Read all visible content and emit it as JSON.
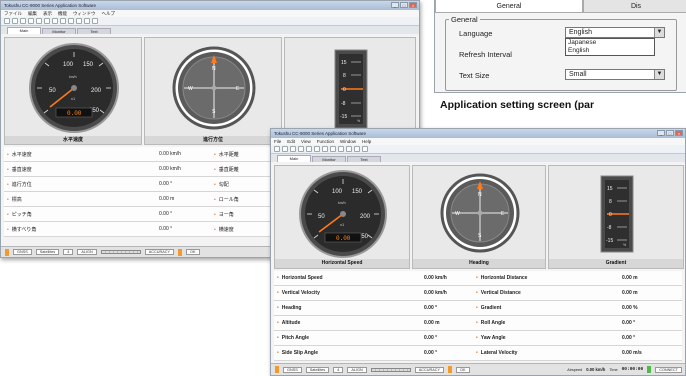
{
  "small_window": {
    "title": "Tokushu CC-9000 Series Application Software",
    "menu": [
      "ファイル",
      "編集",
      "表示",
      "機能",
      "ウィンドウ",
      "ヘルプ"
    ],
    "tabs": [
      "Main",
      "Monitor",
      "Text"
    ],
    "speed_panel": {
      "caption": "水平速度",
      "value": "0.00",
      "unit": "km/h",
      "ticks": [
        "50",
        "100",
        "150",
        "200",
        "250"
      ],
      "multiplier": "x1"
    },
    "heading_panel": {
      "caption": "進行方位",
      "letters": [
        "N",
        "E",
        "S",
        "W"
      ]
    },
    "gradient_panel": {
      "ticks": [
        "15",
        "8",
        "0",
        "-8",
        "-15"
      ],
      "unit": "%"
    },
    "rows": [
      {
        "left_label": "水平速度",
        "left_value": "0.00",
        "left_unit": "km/h",
        "right_label": "水平距離"
      },
      {
        "left_label": "垂直速度",
        "left_value": "0.00",
        "left_unit": "km/h",
        "right_label": "垂直距離"
      },
      {
        "left_label": "進行方位",
        "left_value": "0.00",
        "left_unit": "°",
        "right_label": "勾配"
      },
      {
        "left_label": "標高",
        "left_value": "0.00",
        "left_unit": "m",
        "right_label": "ロール角"
      },
      {
        "left_label": "ピッチ角",
        "left_value": "0.00",
        "left_unit": "°",
        "right_label": "ヨー角"
      },
      {
        "left_label": "横すべり角",
        "left_value": "0.00",
        "left_unit": "°",
        "right_label": "横速度"
      }
    ],
    "status": {
      "item1": "GNSS",
      "item2": "Satellites",
      "item3": "4",
      "item4": "ALIGN",
      "item5": "ACCURACY",
      "item6": "OK"
    }
  },
  "settings_dialog": {
    "tabs": [
      "General",
      "Dis"
    ],
    "group": "General",
    "language_label": "Language",
    "language_value": "English",
    "language_options": [
      "Japanese",
      "English"
    ],
    "refresh_label": "Refresh Interval",
    "text_size_label": "Text Size",
    "text_size_value": "Small",
    "caption": "Application setting screen (par"
  },
  "large_window": {
    "title": "Tokushu CC-9000 Series Application Software",
    "menu": [
      "File",
      "Edit",
      "View",
      "Function",
      "Window",
      "Help"
    ],
    "tabs": [
      "Main",
      "Monitor",
      "Text"
    ],
    "speed_panel": {
      "caption": "Horizontal Speed",
      "value": "0.00",
      "unit": "km/h",
      "ticks": [
        "50",
        "100",
        "150",
        "200",
        "250"
      ],
      "multiplier": "x1"
    },
    "heading_panel": {
      "caption": "Heading",
      "letters": [
        "N",
        "E",
        "S",
        "W"
      ]
    },
    "gradient_panel": {
      "caption": "Gradient",
      "ticks": [
        "15",
        "8",
        "0",
        "-8",
        "-15"
      ],
      "unit": "%"
    },
    "rows": [
      {
        "left_label": "Horizontal Speed",
        "left_value": "0.00",
        "left_unit": "km/h",
        "right_label": "Horizontal Distance",
        "right_value": "0.00",
        "right_unit": "m"
      },
      {
        "left_label": "Vertical Velocity",
        "left_value": "0.00",
        "left_unit": "km/h",
        "right_label": "Vertical Distance",
        "right_value": "0.00",
        "right_unit": "m"
      },
      {
        "left_label": "Heading",
        "left_value": "0.00",
        "left_unit": "°",
        "right_label": "Gradient",
        "right_value": "0.00",
        "right_unit": "%"
      },
      {
        "left_label": "Altitude",
        "left_value": "0.00",
        "left_unit": "m",
        "right_label": "Roll Angle",
        "right_value": "0.00",
        "right_unit": "°"
      },
      {
        "left_label": "Pitch Angle",
        "left_value": "0.00",
        "left_unit": "°",
        "right_label": "Yaw Angle",
        "right_value": "0.00",
        "right_unit": "°"
      },
      {
        "left_label": "Side Slip Angle",
        "left_value": "0.00",
        "left_unit": "°",
        "right_label": "Lateral Velocity",
        "right_value": "0.00",
        "right_unit": "m/s"
      }
    ],
    "status": {
      "item1": "GNSS",
      "item2": "Satellites",
      "item3": "4",
      "item4": "ALIGN",
      "item5": "ACCURACY",
      "item6": "OK",
      "speed_label": "Airspeed",
      "speed_value": "0.00",
      "speed_unit": "km/h",
      "time_label": "Time",
      "time_value": "00:00:00",
      "connect": "CONNECT"
    }
  },
  "colors": {
    "accent_orange": "#e57a25",
    "status_green": "#53b84a",
    "lcd_text": "#ff8a1e",
    "gauge_face": "#2b2b2b"
  }
}
